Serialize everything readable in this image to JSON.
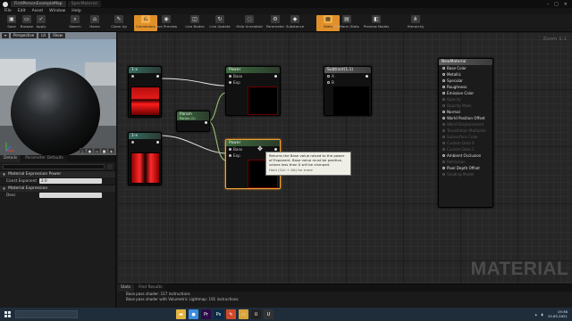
{
  "titlebar": {
    "tabs": [
      "FirstPersonExampleMap",
      "SpecMaterial"
    ]
  },
  "menu": [
    "File",
    "Edit",
    "Asset",
    "Window",
    "Help"
  ],
  "toolbar": {
    "buttons": [
      {
        "label": "Save",
        "icon": "save-icon",
        "glyph": "▣"
      },
      {
        "label": "Browse",
        "icon": "folder-icon",
        "glyph": "▭"
      },
      {
        "label": "Apply",
        "icon": "check-icon",
        "glyph": "✓"
      },
      {
        "label": "Search",
        "icon": "search-icon",
        "glyph": "⌕"
      },
      {
        "label": "Home",
        "icon": "home-icon",
        "glyph": "⌂"
      },
      {
        "label": "Clean Up",
        "icon": "broom-icon",
        "glyph": "✎"
      },
      {
        "label": "Connectors",
        "icon": "connectors-icon",
        "glyph": "⎌"
      },
      {
        "label": "Live Preview",
        "icon": "preview-icon",
        "glyph": "◉"
      },
      {
        "label": "Live Nodes",
        "icon": "nodes-icon",
        "glyph": "◫"
      },
      {
        "label": "Live Update",
        "icon": "refresh-icon",
        "glyph": "↻"
      },
      {
        "label": "Hide Unrelated",
        "icon": "hide-icon",
        "glyph": "◌"
      },
      {
        "label": "Parameter",
        "icon": "parameter-icon",
        "glyph": "⚙"
      },
      {
        "label": "Substance",
        "icon": "substance-icon",
        "glyph": "◆"
      },
      {
        "label": "Stats",
        "icon": "stats-icon",
        "glyph": "▦"
      },
      {
        "label": "Platform Stats",
        "icon": "platform-icon",
        "glyph": "▤"
      },
      {
        "label": "Preview Nodes",
        "icon": "preview-nodes-icon",
        "glyph": "◧"
      },
      {
        "label": "Hierarchy",
        "icon": "hierarchy-icon",
        "glyph": "⋔"
      }
    ],
    "accent": "#e0902a"
  },
  "viewport": {
    "perspective": "Perspective",
    "lit": "Lit",
    "show": "Show"
  },
  "details": {
    "tabs": [
      "Details",
      "Parameter Defaults"
    ],
    "section1": "Material Expression Power",
    "const_label": "Const Exponent",
    "const_value": "2.0",
    "section2": "Material Expression",
    "desc_label": "Desc"
  },
  "graph": {
    "zoom": "Zoom 1:1",
    "watermark": "MATERIAL",
    "nodes": {
      "x1_top": "1-x",
      "x1_bottom": "1-x",
      "power_top": "Power",
      "power_bottom": "Power",
      "param_title": "Param",
      "param_sub": "Param (1)",
      "subtract": "Subtract(1,1)",
      "base": "Base",
      "exp": "Exp",
      "a": "A",
      "b": "B"
    },
    "material": {
      "title": "NewMaterial",
      "pins": [
        {
          "label": "Base Color",
          "on": true
        },
        {
          "label": "Metallic",
          "on": true
        },
        {
          "label": "Specular",
          "on": true
        },
        {
          "label": "Roughness",
          "on": true
        },
        {
          "label": "Emissive Color",
          "on": true
        },
        {
          "label": "Opacity",
          "on": false
        },
        {
          "label": "Opacity Mask",
          "on": false
        },
        {
          "label": "Normal",
          "on": true
        },
        {
          "label": "World Position Offset",
          "on": true
        },
        {
          "label": "World Displacement",
          "on": false
        },
        {
          "label": "Tessellation Multiplier",
          "on": false
        },
        {
          "label": "Subsurface Color",
          "on": false
        },
        {
          "label": "Custom Data 0",
          "on": false
        },
        {
          "label": "Custom Data 1",
          "on": false
        },
        {
          "label": "Ambient Occlusion",
          "on": true
        },
        {
          "label": "Refraction",
          "on": false
        },
        {
          "label": "Pixel Depth Offset",
          "on": true
        },
        {
          "label": "Shading Model",
          "on": false
        }
      ]
    },
    "tooltip": {
      "text": "Returns the Base value raised to the power of Exponent. Base value must be positive, values less than 0 will be clamped.",
      "sub": "Hold (Ctrl + Alt) for more"
    }
  },
  "stats": {
    "tabs": [
      "Stats",
      "Find Results"
    ],
    "lines": [
      "Base pass shader: 117 instructions",
      "Base pass shader with Volumetric Lightmap: 191 instructions"
    ]
  },
  "taskbar": {
    "apps": [
      {
        "icon": "file-explorer-icon",
        "color": "#e3b341",
        "glyph": "▬"
      },
      {
        "icon": "chrome-icon",
        "color": "#3a8de0",
        "glyph": "●"
      },
      {
        "icon": "premiere-icon",
        "color": "#2a0a48",
        "glyph": "Pr"
      },
      {
        "icon": "photoshop-icon",
        "color": "#0a2a48",
        "glyph": "Ps"
      },
      {
        "icon": "paint-icon",
        "color": "#cc4a2a",
        "glyph": "✎"
      },
      {
        "icon": "folder-icon",
        "color": "#d8a43a",
        "glyph": "▭"
      },
      {
        "icon": "unreal-icon",
        "color": "#222222",
        "glyph": "U"
      },
      {
        "icon": "unreal-editor-icon",
        "color": "#333333",
        "glyph": "U"
      }
    ],
    "time": "19:36",
    "date": "15.05.2021"
  }
}
